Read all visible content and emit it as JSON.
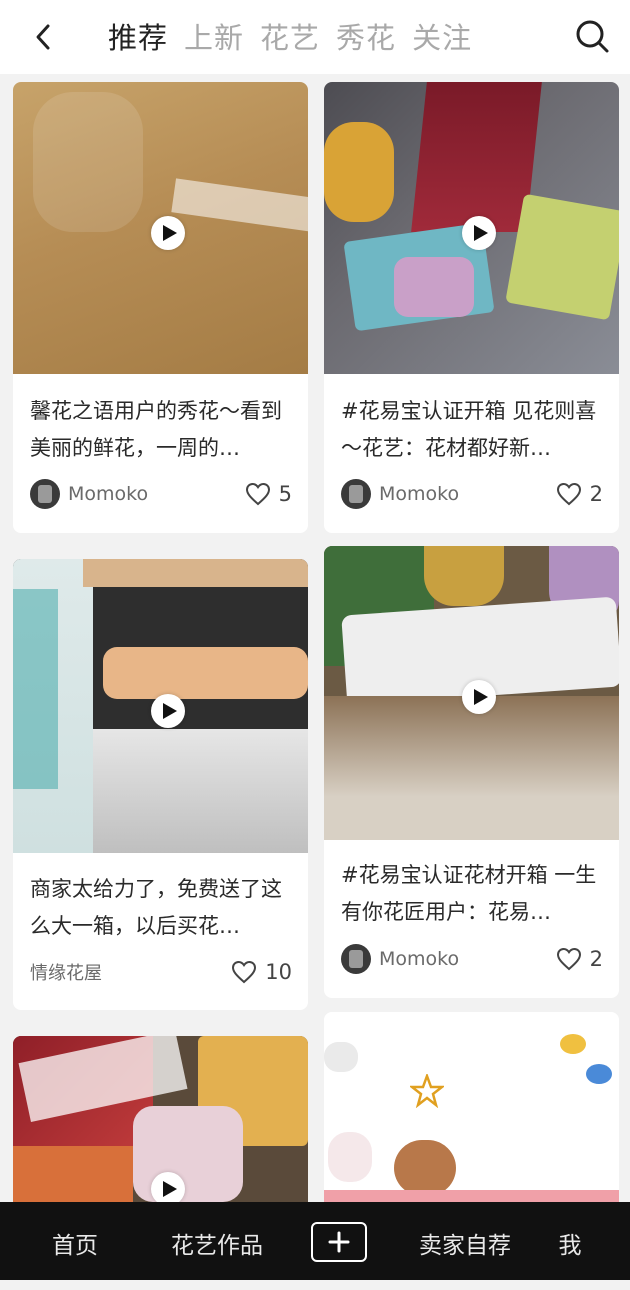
{
  "header": {
    "tabs": [
      {
        "label": "推荐",
        "active": true
      },
      {
        "label": "上新",
        "active": false
      },
      {
        "label": "花艺",
        "active": false
      },
      {
        "label": "秀花",
        "active": false
      },
      {
        "label": "关注",
        "active": false
      }
    ],
    "back_icon": "chevron-left-icon",
    "search_icon": "search-icon"
  },
  "feed": {
    "cards": [
      {
        "title": "馨花之语用户的秀花～看到美丽的鲜花，一周的…",
        "author": "Momoko",
        "likes": "5",
        "has_avatar": true,
        "thumb_colors": [
          "#b9925a",
          "#d2b07a",
          "#a88348"
        ]
      },
      {
        "title": "#花易宝认证开箱 见花则喜～花艺：花材都好新…",
        "author": "Momoko",
        "likes": "2",
        "has_avatar": true,
        "thumb_colors": [
          "#5a5a60",
          "#8a3040",
          "#6aa0b0"
        ]
      },
      {
        "title": "商家太给力了，免费送了这么大一箱，以后买花…",
        "author": "情缘花屋",
        "likes": "10",
        "has_avatar": false,
        "thumb_colors": [
          "#3a3a3a",
          "#e7b78f",
          "#c8c8c8"
        ]
      },
      {
        "title": "#花易宝认证花材开箱 一生有你花匠用户：花易…",
        "author": "Momoko",
        "likes": "2",
        "has_avatar": true,
        "thumb_colors": [
          "#6b5a44",
          "#e8e8e8",
          "#3f6a3a"
        ]
      },
      {
        "title": "",
        "author": "",
        "likes": "",
        "has_avatar": false,
        "thumb_colors": [
          "#9a2a2a",
          "#e8a848",
          "#ffffff"
        ]
      },
      {
        "title": "",
        "author": "",
        "likes": "",
        "has_avatar": false,
        "thumb_colors": [
          "#ffffff",
          "#c08850",
          "#f0b0b8"
        ]
      }
    ]
  },
  "bottom_nav": {
    "items": [
      "首页",
      "花艺作品",
      "卖家自荐",
      "我"
    ],
    "plus_icon": "plus-icon"
  }
}
